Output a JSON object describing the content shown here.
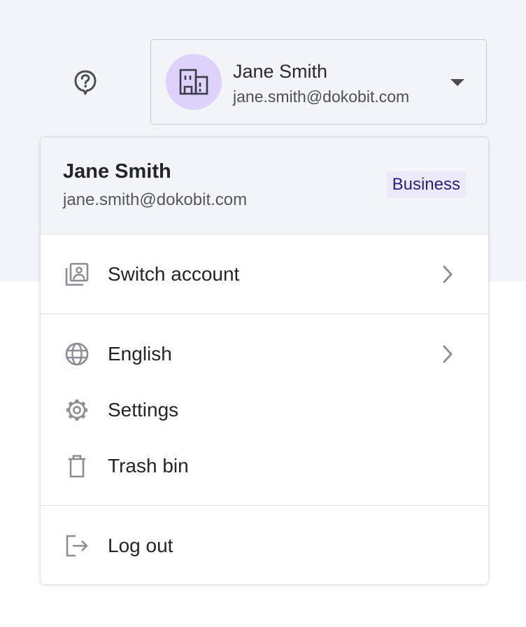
{
  "header": {
    "help_icon": "help-circle-icon",
    "account": {
      "name": "Jane Smith",
      "email": "jane.smith@dokobit.com",
      "avatar_icon": "building-icon",
      "avatar_color": "#dcd2fb",
      "caret_icon": "caret-down-icon"
    }
  },
  "menu": {
    "header": {
      "name": "Jane Smith",
      "email": "jane.smith@dokobit.com",
      "badge": "Business",
      "badge_color": "#2d1e7e"
    },
    "items": [
      {
        "label": "Switch account",
        "icon": "switch-account-icon",
        "has_submenu": true
      },
      {
        "label": "English",
        "icon": "globe-icon",
        "has_submenu": true
      },
      {
        "label": "Settings",
        "icon": "gear-icon",
        "has_submenu": false
      },
      {
        "label": "Trash bin",
        "icon": "trash-icon",
        "has_submenu": false
      },
      {
        "label": "Log out",
        "icon": "logout-icon",
        "has_submenu": false
      }
    ]
  },
  "colors": {
    "top_background": "#f3f4f8",
    "icon_gray": "#8b8d96",
    "text": "#24252b"
  }
}
